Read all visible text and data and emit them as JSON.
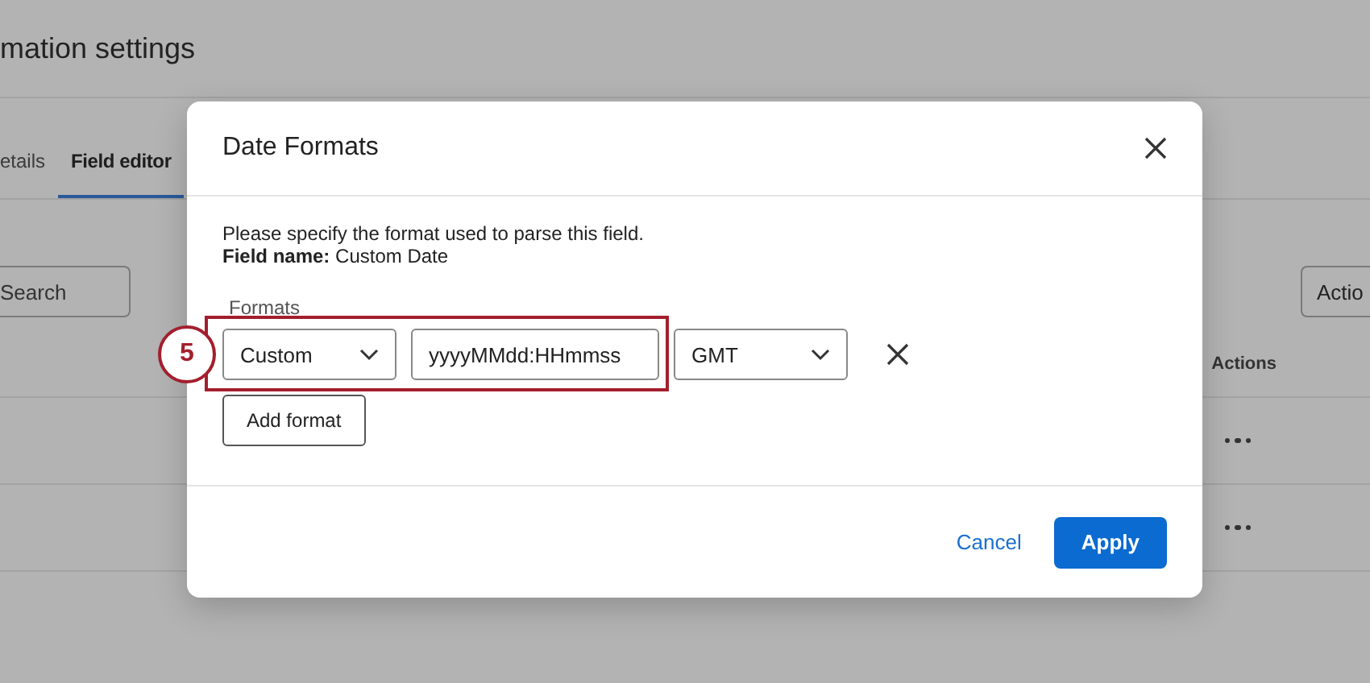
{
  "page": {
    "title": "mation settings",
    "tabs": [
      {
        "label": "etails",
        "selected": false
      },
      {
        "label": "Field editor",
        "selected": true
      }
    ],
    "search": {
      "placeholder": "Search"
    },
    "actions_button": "Actio",
    "table": {
      "columns": [
        "Actions"
      ],
      "rows": [
        {
          "has_menu": true
        },
        {
          "has_menu": true
        }
      ]
    }
  },
  "dialog": {
    "title": "Date Formats",
    "description": "Please specify the format used to parse this field.",
    "field_name": "**Field name:** Custom Date",
    "formats_label": "Formats",
    "formats": [
      {
        "type": "Custom",
        "pattern": "yyyyMMdd:HHmmss",
        "timezone": "GMT"
      }
    ],
    "add_button": "Add format",
    "cancel_button": "Cancel",
    "apply_button": "Apply"
  },
  "step_marker": "5"
}
